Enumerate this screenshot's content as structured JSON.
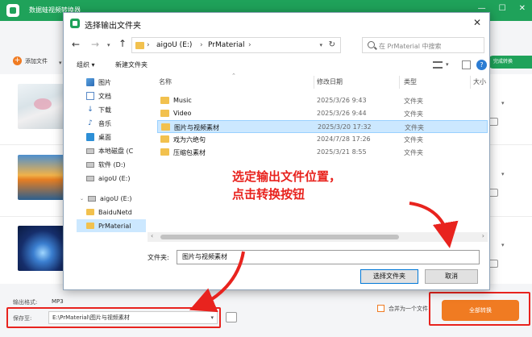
{
  "app": {
    "title": "数据蛙视频转换器",
    "add_file_label": "添加文件",
    "complete_label": "完成转换",
    "format_label": "输出格式:",
    "format_value": "MP3",
    "save_label": "保存至:",
    "save_path": "E:\\PrMaterial\\图片与视频素材",
    "merge_label": "合并为一个文件",
    "convert_all_label": "全部转换",
    "winbtns": [
      "—",
      "☐",
      "✕"
    ]
  },
  "dialog": {
    "title": "选择输出文件夹",
    "address": [
      "aigoU (E:)",
      "PrMaterial"
    ],
    "search_placeholder": "在 PrMaterial 中搜索",
    "organize_label": "组织 ▾",
    "new_folder_label": "新建文件夹",
    "columns": {
      "name": "名称",
      "date": "修改日期",
      "type": "类型",
      "size": "大小"
    },
    "nav_items": [
      {
        "label": "图片",
        "icon": "pictures-icon"
      },
      {
        "label": "文档",
        "icon": "documents-icon"
      },
      {
        "label": "下载",
        "icon": "downloads-icon"
      },
      {
        "label": "音乐",
        "icon": "music-icon"
      },
      {
        "label": "桌面",
        "icon": "desktop-icon"
      },
      {
        "label": "本地磁盘 (C",
        "icon": "drive-icon"
      },
      {
        "label": "软件 (D:)",
        "icon": "drive-icon"
      },
      {
        "label": "aigoU (E:)",
        "icon": "drive-icon"
      },
      {
        "label": "aigoU (E:)",
        "icon": "usb-drive-icon"
      },
      {
        "label": "BaiduNetd",
        "icon": "folder-icon"
      },
      {
        "label": "PrMaterial",
        "icon": "folder-icon"
      }
    ],
    "files": [
      {
        "name": "Music",
        "date": "2025/3/26 9:43",
        "type": "文件夹"
      },
      {
        "name": "Video",
        "date": "2025/3/26 9:44",
        "type": "文件夹"
      },
      {
        "name": "图片与视频素材",
        "date": "2025/3/20 17:32",
        "type": "文件夹"
      },
      {
        "name": "戏为六绝句",
        "date": "2024/7/28 17:26",
        "type": "文件夹"
      },
      {
        "name": "压缩包素材",
        "date": "2025/3/21 8:55",
        "type": "文件夹"
      }
    ],
    "filename_label": "文件夹:",
    "filename_value": "图片与视频素材",
    "select_button": "选择文件夹",
    "cancel_button": "取消"
  },
  "annotation": {
    "line1": "选定输出文件位置，",
    "line2": "点击转换按钮",
    "color": "#e8231e"
  },
  "colors": {
    "brand_green": "#1fa25a",
    "accent_orange": "#f07b22",
    "highlight_red": "#e8231e",
    "selection_blue": "#cce8ff"
  }
}
